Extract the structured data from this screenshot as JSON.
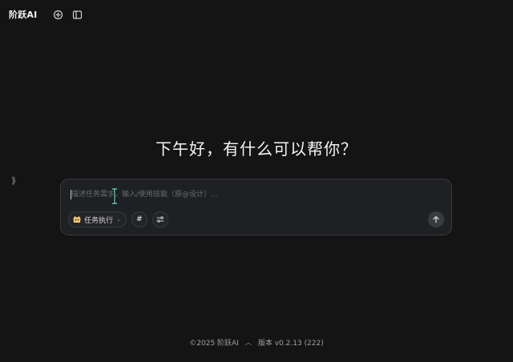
{
  "app": {
    "logo_text": "阶跃AI"
  },
  "topbar": {
    "icons": [
      "new-chat-icon",
      "sidebar-toggle-icon"
    ]
  },
  "sidebar": {
    "expand_glyph": "⟫"
  },
  "main": {
    "greeting": "下午好，有什么可以帮你？"
  },
  "composer": {
    "placeholder": "描述任务需求，输入/使用技能（原@设计）...",
    "value": "",
    "mode": {
      "label": "任务执行",
      "icon": "task-mode-icon"
    },
    "hash_label": "#",
    "tools_icon": "tools-icon",
    "send_icon": "arrow-up-icon"
  },
  "footer": {
    "copyright": "©2025 阶跃AI",
    "version": "版本 v0.2.13 (222)"
  },
  "colors": {
    "background": "#141414",
    "composer_bg": "#1f2024",
    "border": "#3a3b3e",
    "text_primary": "#f4f4f4",
    "text_muted": "#a0a0a0",
    "mode_icon": "#f4c471"
  }
}
